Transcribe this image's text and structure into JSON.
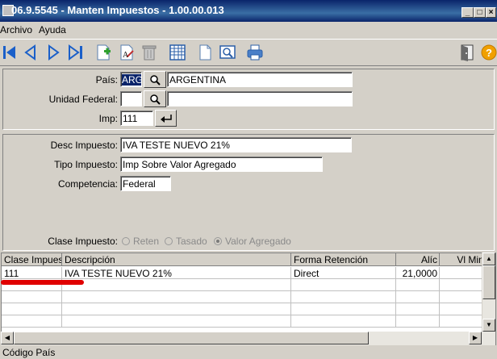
{
  "window": {
    "title": "06.9.5545 - Manten Impuestos - 1.00.00.013"
  },
  "menu": {
    "items": [
      "Archivo",
      "Ayuda"
    ]
  },
  "header_panel": {
    "pais_label": "País:",
    "pais_code": "ARG",
    "pais_name": "ARGENTINA",
    "unidad_label": "Unidad Federal:",
    "unidad_code": "",
    "unidad_name": "",
    "imp_label": "Imp:",
    "imp_value": "111"
  },
  "detail_panel": {
    "desc_label": "Desc Impuesto:",
    "desc_value": "IVA TESTE NUEVO 21%",
    "tipo_label": "Tipo Impuesto:",
    "tipo_value": "Imp Sobre Valor Agregado",
    "competencia_label": "Competencia:",
    "competencia_value": "Federal",
    "clase_label": "Clase Impuesto:",
    "clase_options": [
      "Reten",
      "Tasado",
      "Valor Agregado"
    ],
    "clase_selected": "Valor Agregado"
  },
  "grid": {
    "columns": [
      "Clase Impuest",
      "Descripción",
      "Forma Retención",
      "Alíc",
      "Vl Min In"
    ],
    "rows": [
      [
        "111",
        "IVA TESTE NUEVO 21%",
        "Direct",
        "21,0000",
        ""
      ]
    ]
  },
  "status": {
    "text": "Código País"
  },
  "colors": {
    "title_bar": "#0a246a",
    "annotation_red": "#e00000",
    "face": "#d4d0c8"
  }
}
